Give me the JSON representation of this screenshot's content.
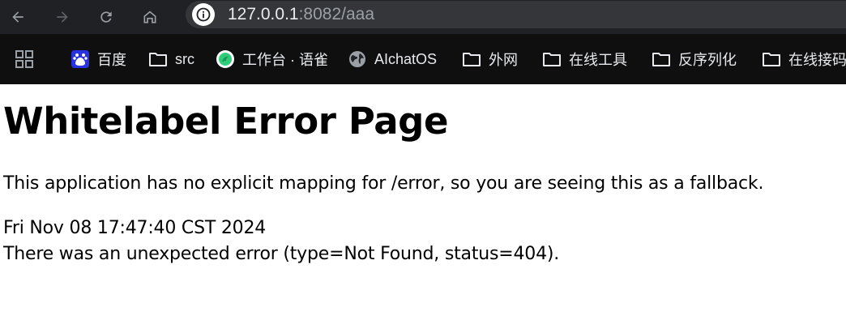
{
  "browser": {
    "url_host": "127.0.0.1",
    "url_rest": ":8082/aaa",
    "bookmarks": [
      {
        "label": "百度",
        "icon": "baidu-icon"
      },
      {
        "label": "src",
        "icon": "folder-icon"
      },
      {
        "label": "工作台 · 语雀",
        "icon": "yuque-icon"
      },
      {
        "label": "AIchatOS",
        "icon": "globe-icon"
      },
      {
        "label": "外网",
        "icon": "folder-icon"
      },
      {
        "label": "在线工具",
        "icon": "folder-icon"
      },
      {
        "label": "反序列化",
        "icon": "folder-icon"
      },
      {
        "label": "在线接码",
        "icon": "folder-icon"
      }
    ]
  },
  "page": {
    "title": "Whitelabel Error Page",
    "message": "This application has no explicit mapping for /error, so you are seeing this as a fallback.",
    "timestamp": "Fri Nov 08 17:47:40 CST 2024",
    "error": "There was an unexpected error (type=Not Found, status=404)."
  }
}
